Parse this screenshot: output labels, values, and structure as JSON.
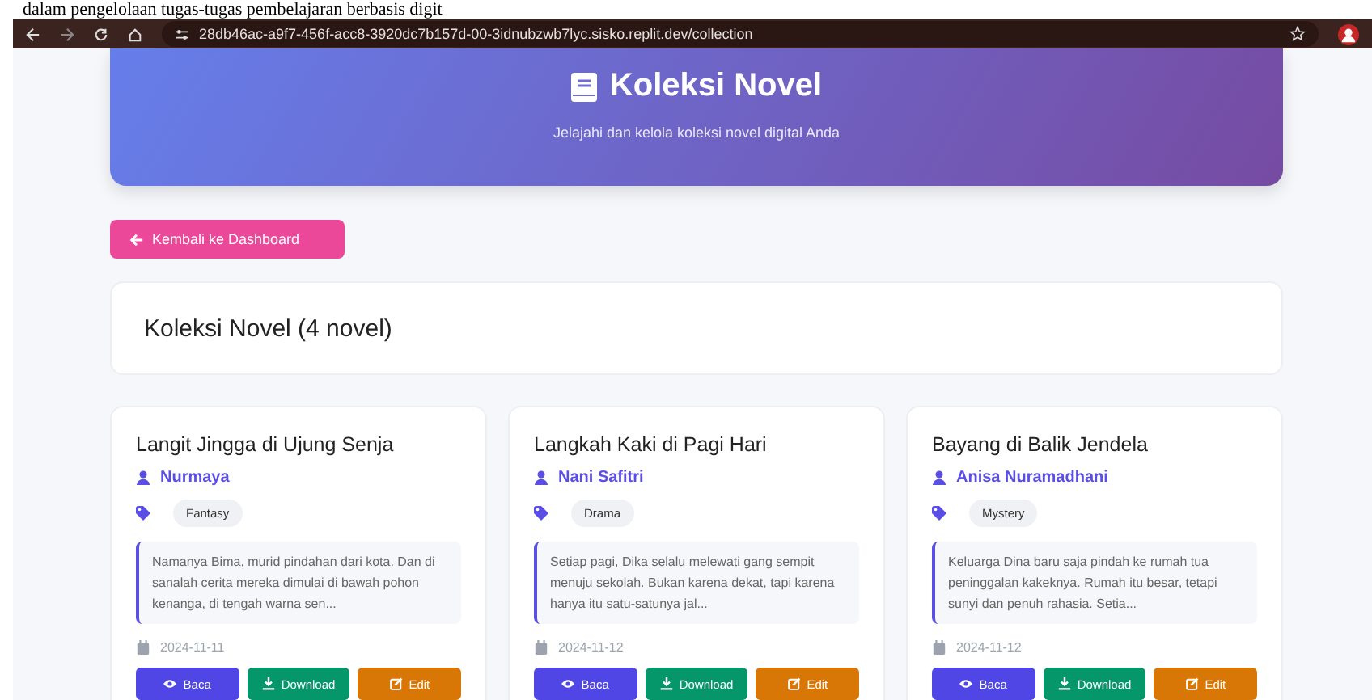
{
  "overlay_text": "dalam pengelolaan tugas-tugas pembelajaran berbasis digit",
  "browser": {
    "url": "28db46ac-a9f7-456f-acc8-3920dc7b157d-00-3idnubzwb7lyc.sisko.replit.dev/collection"
  },
  "header": {
    "title": "Koleksi Novel",
    "subtitle": "Jelajahi dan kelola koleksi novel digital Anda"
  },
  "back_button": "Kembali ke Dashboard",
  "collection_title": "Koleksi Novel (4 novel)",
  "novels": [
    {
      "title": "Langit Jingga di Ujung Senja",
      "author": "Nurmaya",
      "genre": "Fantasy",
      "excerpt": "Namanya Bima, murid pindahan dari kota. Dan di sanalah cerita mereka dimulai di bawah pohon kenanga, di tengah warna sen...",
      "date": "2024-11-11",
      "actions": [
        "Baca",
        "Download",
        "Edit"
      ]
    },
    {
      "title": "Langkah Kaki di Pagi Hari",
      "author": "Nani Safitri",
      "genre": "Drama",
      "excerpt": "Setiap pagi, Dika selalu melewati gang sempit menuju sekolah. Bukan karena dekat, tapi karena hanya itu satu-satunya jal...",
      "date": "2024-11-12",
      "actions": [
        "Baca",
        "Download",
        "Edit"
      ]
    },
    {
      "title": "Bayang di Balik Jendela",
      "author": "Anisa Nuramadhani",
      "genre": "Mystery",
      "excerpt": "Keluarga Dina baru saja pindah ke rumah tua peninggalan kakeknya. Rumah itu besar, tetapi sunyi dan penuh rahasia. Setia...",
      "date": "2024-11-12",
      "actions": [
        "Baca",
        "Download",
        "Edit"
      ]
    }
  ]
}
